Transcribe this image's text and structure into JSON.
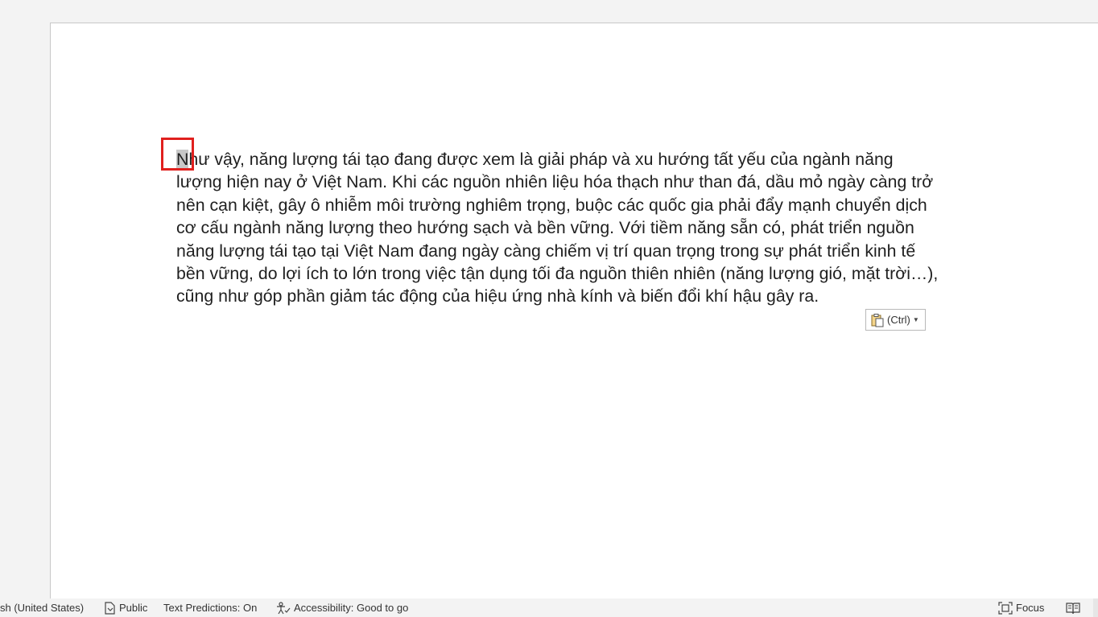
{
  "document": {
    "selected_char": "N",
    "paragraph_rest": "hư vậy, năng lượng tái tạo đang được xem là giải pháp và xu hướng tất yếu của ngành năng\nlượng hiện nay ở Việt Nam. Khi các nguồn nhiên liệu hóa thạch như than đá, dầu mỏ ngày càng trở\nnên cạn kiệt, gây ô nhiễm môi trường nghiêm trọng, buộc các quốc gia phải đẩy mạnh chuyển dịch\ncơ cấu ngành năng lượng theo hướng sạch và bền vững. Với tiềm năng sẵn có, phát triển nguồn\nnăng lượng tái tạo tại Việt Nam đang ngày càng chiếm vị trí quan trọng trong sự phát triển kinh tế\nbền vững, do lợi ích to lớn trong việc tận dụng tối đa nguồn thiên nhiên (năng lượng gió, mặt trời…),\ncũng như góp phần giảm tác động của hiệu ứng nhà kính và biến đổi khí hậu gây ra."
  },
  "paste_options": {
    "label": "(Ctrl)",
    "icon": "clipboard-icon"
  },
  "statusbar": {
    "language": "sh (United States)",
    "sensitivity": "Public",
    "text_predictions": "Text Predictions: On",
    "accessibility": "Accessibility: Good to go",
    "focus": "Focus"
  },
  "colors": {
    "highlight_box": "#e0201e",
    "selection": "#c8c8c8"
  }
}
